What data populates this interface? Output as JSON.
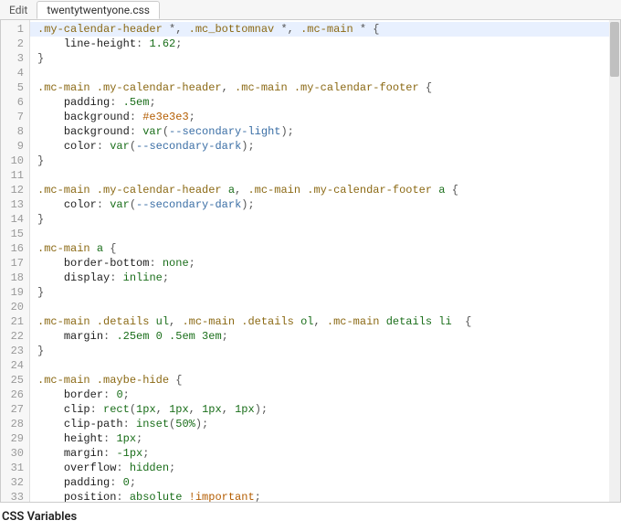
{
  "tabs": {
    "edit": "Edit",
    "file": "twentytwentyone.css"
  },
  "footer": "CSS Variables",
  "lineCount": 33,
  "code": [
    [
      {
        "c": "sel",
        "t": ".my-calendar-header"
      },
      {
        "c": "punct",
        "t": " *, "
      },
      {
        "c": "sel",
        "t": ".mc_bottomnav"
      },
      {
        "c": "punct",
        "t": " *, "
      },
      {
        "c": "sel",
        "t": ".mc-main"
      },
      {
        "c": "punct",
        "t": " * {"
      }
    ],
    [
      {
        "c": "",
        "t": "    "
      },
      {
        "c": "prop",
        "t": "line-height"
      },
      {
        "c": "punct",
        "t": ": "
      },
      {
        "c": "num",
        "t": "1.62"
      },
      {
        "c": "punct",
        "t": ";"
      }
    ],
    [
      {
        "c": "punct",
        "t": "}"
      }
    ],
    [
      {
        "c": "",
        "t": ""
      }
    ],
    [
      {
        "c": "sel",
        "t": ".mc-main .my-calendar-header"
      },
      {
        "c": "punct",
        "t": ", "
      },
      {
        "c": "sel",
        "t": ".mc-main .my-calendar-footer"
      },
      {
        "c": "punct",
        "t": " {"
      }
    ],
    [
      {
        "c": "",
        "t": "    "
      },
      {
        "c": "prop",
        "t": "padding"
      },
      {
        "c": "punct",
        "t": ": "
      },
      {
        "c": "num",
        "t": ".5em"
      },
      {
        "c": "punct",
        "t": ";"
      }
    ],
    [
      {
        "c": "",
        "t": "    "
      },
      {
        "c": "prop",
        "t": "background"
      },
      {
        "c": "punct",
        "t": ": "
      },
      {
        "c": "str",
        "t": "#e3e3e3"
      },
      {
        "c": "punct",
        "t": ";"
      }
    ],
    [
      {
        "c": "",
        "t": "    "
      },
      {
        "c": "prop",
        "t": "background"
      },
      {
        "c": "punct",
        "t": ": "
      },
      {
        "c": "kw",
        "t": "var"
      },
      {
        "c": "punct",
        "t": "("
      },
      {
        "c": "var",
        "t": "--secondary-light"
      },
      {
        "c": "punct",
        "t": ");"
      }
    ],
    [
      {
        "c": "",
        "t": "    "
      },
      {
        "c": "prop",
        "t": "color"
      },
      {
        "c": "punct",
        "t": ": "
      },
      {
        "c": "kw",
        "t": "var"
      },
      {
        "c": "punct",
        "t": "("
      },
      {
        "c": "var",
        "t": "--secondary-dark"
      },
      {
        "c": "punct",
        "t": ");"
      }
    ],
    [
      {
        "c": "punct",
        "t": "}"
      }
    ],
    [
      {
        "c": "",
        "t": ""
      }
    ],
    [
      {
        "c": "sel",
        "t": ".mc-main .my-calendar-header"
      },
      {
        "c": "punct",
        "t": " "
      },
      {
        "c": "kw",
        "t": "a"
      },
      {
        "c": "punct",
        "t": ", "
      },
      {
        "c": "sel",
        "t": ".mc-main .my-calendar-footer"
      },
      {
        "c": "punct",
        "t": " "
      },
      {
        "c": "kw",
        "t": "a"
      },
      {
        "c": "punct",
        "t": " {"
      }
    ],
    [
      {
        "c": "",
        "t": "    "
      },
      {
        "c": "prop",
        "t": "color"
      },
      {
        "c": "punct",
        "t": ": "
      },
      {
        "c": "kw",
        "t": "var"
      },
      {
        "c": "punct",
        "t": "("
      },
      {
        "c": "var",
        "t": "--secondary-dark"
      },
      {
        "c": "punct",
        "t": ");"
      }
    ],
    [
      {
        "c": "punct",
        "t": "}"
      }
    ],
    [
      {
        "c": "",
        "t": ""
      }
    ],
    [
      {
        "c": "sel",
        "t": ".mc-main"
      },
      {
        "c": "punct",
        "t": " "
      },
      {
        "c": "kw",
        "t": "a"
      },
      {
        "c": "punct",
        "t": " {"
      }
    ],
    [
      {
        "c": "",
        "t": "    "
      },
      {
        "c": "prop",
        "t": "border-bottom"
      },
      {
        "c": "punct",
        "t": ": "
      },
      {
        "c": "kw",
        "t": "none"
      },
      {
        "c": "punct",
        "t": ";"
      }
    ],
    [
      {
        "c": "",
        "t": "    "
      },
      {
        "c": "prop",
        "t": "display"
      },
      {
        "c": "punct",
        "t": ": "
      },
      {
        "c": "kw",
        "t": "inline"
      },
      {
        "c": "punct",
        "t": ";"
      }
    ],
    [
      {
        "c": "punct",
        "t": "}"
      }
    ],
    [
      {
        "c": "",
        "t": ""
      }
    ],
    [
      {
        "c": "sel",
        "t": ".mc-main .details"
      },
      {
        "c": "punct",
        "t": " "
      },
      {
        "c": "kw",
        "t": "ul"
      },
      {
        "c": "punct",
        "t": ", "
      },
      {
        "c": "sel",
        "t": ".mc-main .details"
      },
      {
        "c": "punct",
        "t": " "
      },
      {
        "c": "kw",
        "t": "ol"
      },
      {
        "c": "punct",
        "t": ", "
      },
      {
        "c": "sel",
        "t": ".mc-main"
      },
      {
        "c": "punct",
        "t": " "
      },
      {
        "c": "kw",
        "t": "details li"
      },
      {
        "c": "punct",
        "t": "  {"
      }
    ],
    [
      {
        "c": "",
        "t": "    "
      },
      {
        "c": "prop",
        "t": "margin"
      },
      {
        "c": "punct",
        "t": ": "
      },
      {
        "c": "num",
        "t": ".25em 0 .5em 3em"
      },
      {
        "c": "punct",
        "t": ";"
      }
    ],
    [
      {
        "c": "punct",
        "t": "}"
      }
    ],
    [
      {
        "c": "",
        "t": ""
      }
    ],
    [
      {
        "c": "sel",
        "t": ".mc-main .maybe-hide"
      },
      {
        "c": "punct",
        "t": " {"
      }
    ],
    [
      {
        "c": "",
        "t": "    "
      },
      {
        "c": "prop",
        "t": "border"
      },
      {
        "c": "punct",
        "t": ": "
      },
      {
        "c": "num",
        "t": "0"
      },
      {
        "c": "punct",
        "t": ";"
      }
    ],
    [
      {
        "c": "",
        "t": "    "
      },
      {
        "c": "prop",
        "t": "clip"
      },
      {
        "c": "punct",
        "t": ": "
      },
      {
        "c": "kw",
        "t": "rect"
      },
      {
        "c": "punct",
        "t": "("
      },
      {
        "c": "num",
        "t": "1px"
      },
      {
        "c": "punct",
        "t": ", "
      },
      {
        "c": "num",
        "t": "1px"
      },
      {
        "c": "punct",
        "t": ", "
      },
      {
        "c": "num",
        "t": "1px"
      },
      {
        "c": "punct",
        "t": ", "
      },
      {
        "c": "num",
        "t": "1px"
      },
      {
        "c": "punct",
        "t": ");"
      }
    ],
    [
      {
        "c": "",
        "t": "    "
      },
      {
        "c": "prop",
        "t": "clip-path"
      },
      {
        "c": "punct",
        "t": ": "
      },
      {
        "c": "kw",
        "t": "inset"
      },
      {
        "c": "punct",
        "t": "("
      },
      {
        "c": "num",
        "t": "50%"
      },
      {
        "c": "punct",
        "t": ");"
      }
    ],
    [
      {
        "c": "",
        "t": "    "
      },
      {
        "c": "prop",
        "t": "height"
      },
      {
        "c": "punct",
        "t": ": "
      },
      {
        "c": "num",
        "t": "1px"
      },
      {
        "c": "punct",
        "t": ";"
      }
    ],
    [
      {
        "c": "",
        "t": "    "
      },
      {
        "c": "prop",
        "t": "margin"
      },
      {
        "c": "punct",
        "t": ": "
      },
      {
        "c": "num",
        "t": "-1px"
      },
      {
        "c": "punct",
        "t": ";"
      }
    ],
    [
      {
        "c": "",
        "t": "    "
      },
      {
        "c": "prop",
        "t": "overflow"
      },
      {
        "c": "punct",
        "t": ": "
      },
      {
        "c": "kw",
        "t": "hidden"
      },
      {
        "c": "punct",
        "t": ";"
      }
    ],
    [
      {
        "c": "",
        "t": "    "
      },
      {
        "c": "prop",
        "t": "padding"
      },
      {
        "c": "punct",
        "t": ": "
      },
      {
        "c": "num",
        "t": "0"
      },
      {
        "c": "punct",
        "t": ";"
      }
    ],
    [
      {
        "c": "",
        "t": "    "
      },
      {
        "c": "prop",
        "t": "position"
      },
      {
        "c": "punct",
        "t": ": "
      },
      {
        "c": "kw",
        "t": "absolute"
      },
      {
        "c": "punct",
        "t": " "
      },
      {
        "c": "str",
        "t": "!important"
      },
      {
        "c": "punct",
        "t": ";"
      }
    ]
  ]
}
